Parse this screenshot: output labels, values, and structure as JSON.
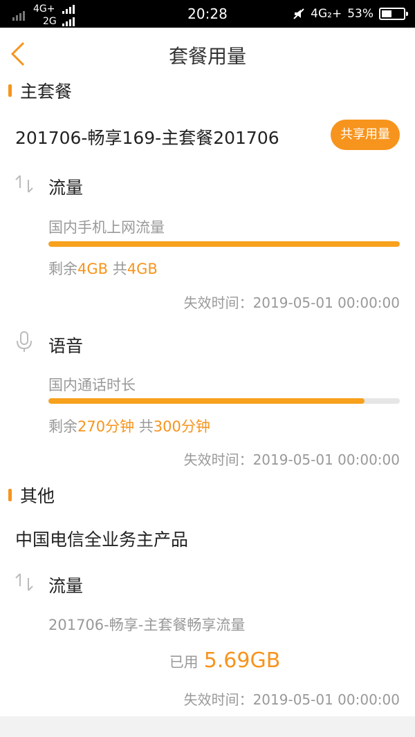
{
  "status": {
    "network1": "4G+",
    "network2": "2G",
    "time": "20:28",
    "network3": "4G₂+",
    "battery": "53%",
    "battery_level": 0.53
  },
  "header": {
    "title": "套餐用量",
    "back_icon": "chevron-left-icon"
  },
  "main_plan": {
    "section_label": "主套餐",
    "plan_name": "201706-畅享169-主套餐201706",
    "share_button": "共享用量",
    "data": {
      "title": "流量",
      "subtitle": "国内手机上网流量",
      "progress": 1.0,
      "remain_prefix": "剩余",
      "remain_value": "4GB",
      "total_prefix": " 共",
      "total_value": "4GB",
      "expire": "失效时间：2019-05-01 00:00:00"
    },
    "voice": {
      "title": "语音",
      "subtitle": "国内通话时长",
      "progress": 0.9,
      "remain_prefix": "剩余",
      "remain_value": "270分钟",
      "total_prefix": " 共",
      "total_value": "300分钟",
      "expire": "失效时间：2019-05-01 00:00:00"
    }
  },
  "other": {
    "section_label": "其他",
    "product_name": "中国电信全业务主产品",
    "data": {
      "title": "流量",
      "subtitle": "201706-畅享-主套餐畅享流量",
      "used_label": "已用",
      "used_value": "5.69GB",
      "expire": "失效时间：2019-05-01 00:00:00"
    }
  },
  "colors": {
    "accent": "#f7941d",
    "progress_track": "#e6e6e6"
  }
}
